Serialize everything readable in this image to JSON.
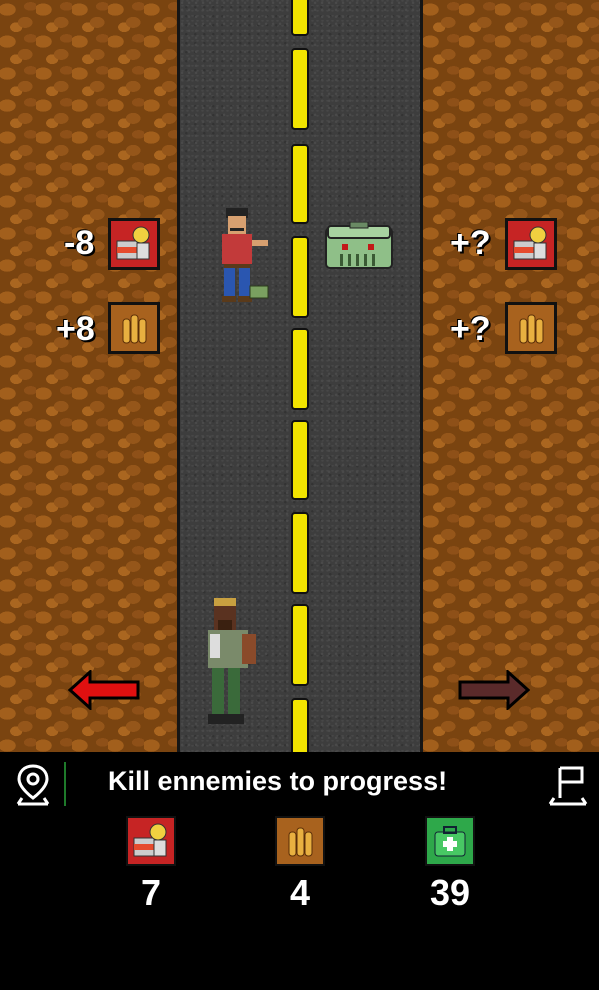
{
  "left_panel": {
    "food_delta": "-8",
    "ammo_delta": "+8",
    "food_icon": "food-can-icon",
    "ammo_icon": "bullets-icon"
  },
  "right_panel": {
    "food_delta": "+?",
    "ammo_delta": "+?",
    "food_icon": "food-can-icon",
    "ammo_icon": "bullets-icon"
  },
  "navigation": {
    "left_arrow": "left-arrow-icon",
    "right_arrow": "right-arrow-icon",
    "left_arrow_color": "#e01010",
    "right_arrow_color": "#5a2a2a"
  },
  "hud": {
    "message": "Kill ennemies to progress!",
    "map_icon": "map-pin-icon",
    "flag_icon": "flag-icon",
    "resources": [
      {
        "icon": "food-can-icon",
        "value": "7"
      },
      {
        "icon": "bullets-icon",
        "value": "4"
      },
      {
        "icon": "medkit-icon",
        "value": "39"
      }
    ]
  },
  "colors": {
    "road": "#3d3d3d",
    "lane_marking": "#f2e400",
    "dirt": "#7a4410",
    "hud_background": "#000000"
  }
}
